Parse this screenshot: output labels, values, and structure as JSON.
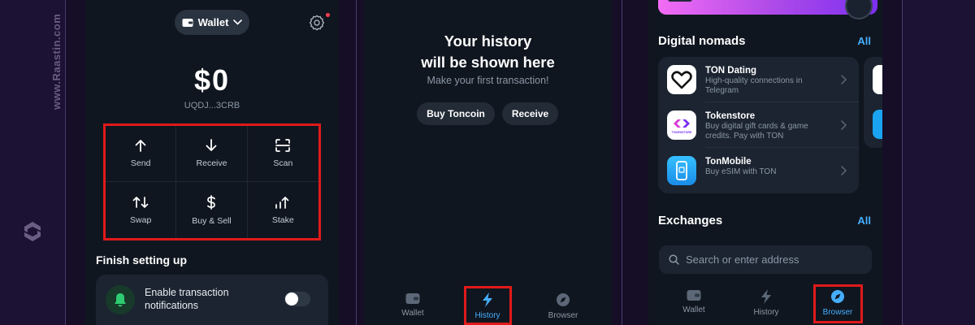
{
  "watermark": {
    "text": "www.Raastin.com"
  },
  "wallet_screen": {
    "wallet_selector": "Wallet",
    "balance": "$0",
    "address": "UQDJ...3CRB",
    "actions": [
      {
        "label": "Send",
        "icon": "arrow-up-icon"
      },
      {
        "label": "Receive",
        "icon": "arrow-down-icon"
      },
      {
        "label": "Scan",
        "icon": "scan-icon"
      },
      {
        "label": "Swap",
        "icon": "swap-icon"
      },
      {
        "label": "Buy & Sell",
        "icon": "dollar-icon"
      },
      {
        "label": "Stake",
        "icon": "stake-icon"
      }
    ],
    "setup_title": "Finish setting up",
    "notification_label": "Enable transaction notifications",
    "notification_enabled": false
  },
  "history_screen": {
    "title_line1": "Your history",
    "title_line2": "will be shown here",
    "subtitle": "Make your first transaction!",
    "buy_button": "Buy Toncoin",
    "receive_button": "Receive",
    "tabs": [
      {
        "label": "Wallet",
        "active": false
      },
      {
        "label": "History",
        "active": true
      },
      {
        "label": "Browser",
        "active": false
      }
    ]
  },
  "browser_screen": {
    "section1_title": "Digital nomads",
    "section1_all": "All",
    "apps": [
      {
        "name": "TON Dating",
        "desc": "High-quality connections in Telegram"
      },
      {
        "name": "Tokenstore",
        "desc": "Buy digital gift cards & game credits. Pay with TON",
        "icon_text": "TOKENSTORE"
      },
      {
        "name": "TonMobile",
        "desc": "Buy eSIM with TON"
      }
    ],
    "section2_title": "Exchanges",
    "section2_all": "All",
    "search_placeholder": "Search or enter address",
    "tabs": [
      {
        "label": "Wallet",
        "active": false
      },
      {
        "label": "History",
        "active": false
      },
      {
        "label": "Browser",
        "active": true
      }
    ]
  },
  "colors": {
    "accent": "#45aeff",
    "highlight": "#e01a1a",
    "background": "#1c1233",
    "phone_bg": "#10161f"
  }
}
